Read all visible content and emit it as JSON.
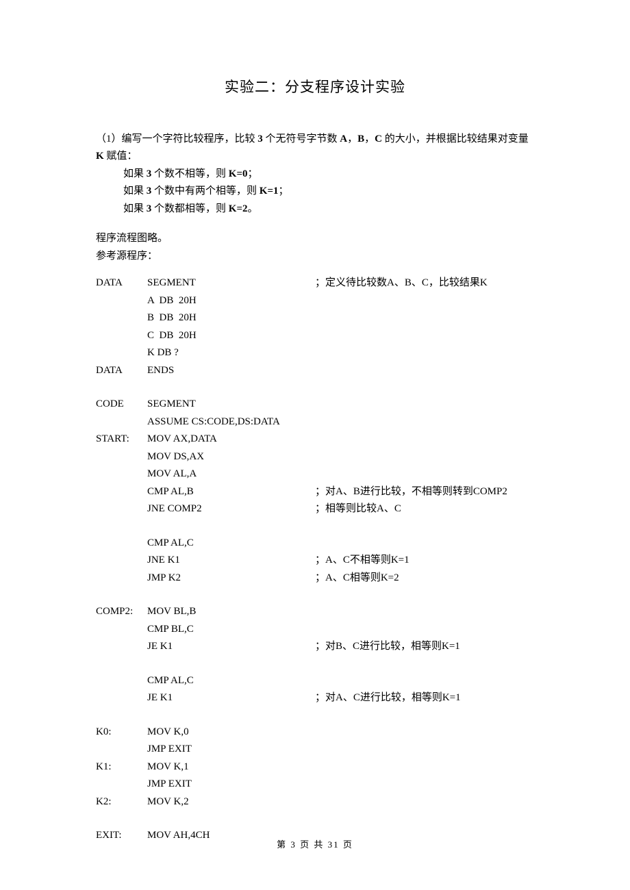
{
  "title": "实验二：分支程序设计实验",
  "intro": {
    "q_prefix": "（1）编写一个字符比较程序，比较 ",
    "q_bold1": "3",
    "q_mid1": " 个无符号字节数 ",
    "q_bold2": "A",
    "q_mid2": "，",
    "q_bold3": "B",
    "q_mid3": "，",
    "q_bold4": "C",
    "q_suffix": " 的大小，并根据比较结果对变量 ",
    "q_bold5": "K",
    "q_suffix2": " 赋值：",
    "cond1_a": "如果 ",
    "cond1_b": "3",
    "cond1_c": " 个数不相等，则 ",
    "cond1_d": "K=0",
    "cond1_e": "；",
    "cond2_a": "如果 ",
    "cond2_b": "3",
    "cond2_c": " 个数中有两个相等，则 ",
    "cond2_d": "K=1",
    "cond2_e": "；",
    "cond3_a": "如果 ",
    "cond3_b": "3",
    "cond3_c": " 个数都相等，则 ",
    "cond3_d": "K=2",
    "cond3_e": "。",
    "flow": "程序流程图略。",
    "ref": "参考源程序："
  },
  "code": [
    {
      "label": "DATA",
      "instr": "SEGMENT",
      "comment": "；定义待比较数A、B、C，比较结果K"
    },
    {
      "label": "",
      "instr": "A  DB  20H",
      "comment": ""
    },
    {
      "label": "",
      "instr": "B  DB  20H",
      "comment": ""
    },
    {
      "label": "",
      "instr": "C  DB  20H",
      "comment": ""
    },
    {
      "label": "",
      "instr": "K DB ?",
      "comment": ""
    },
    {
      "label": "DATA",
      "instr": "ENDS",
      "comment": ""
    },
    {
      "blank": true
    },
    {
      "label": "CODE",
      "instr": "SEGMENT",
      "comment": ""
    },
    {
      "label": "",
      "instr": "ASSUME CS:CODE,DS:DATA",
      "comment": ""
    },
    {
      "label": "START:",
      "instr": "MOV AX,DATA",
      "comment": ""
    },
    {
      "label": "",
      "instr": "MOV DS,AX",
      "comment": ""
    },
    {
      "label": "",
      "instr": "MOV AL,A",
      "comment": ""
    },
    {
      "label": "",
      "instr": "CMP AL,B",
      "comment": "；对A、B进行比较，不相等则转到COMP2"
    },
    {
      "label": "",
      "instr": "JNE COMP2",
      "comment": "；相等则比较A、C"
    },
    {
      "blank": true
    },
    {
      "label": "",
      "instr": "CMP AL,C",
      "comment": ""
    },
    {
      "label": "",
      "instr": "JNE K1",
      "comment": "；A、C不相等则K=1"
    },
    {
      "label": "",
      "instr": "JMP K2",
      "comment": "；A、C相等则K=2"
    },
    {
      "blank": true
    },
    {
      "label": "COMP2:",
      "instr": "MOV BL,B",
      "comment": ""
    },
    {
      "label": "",
      "instr": "CMP BL,C",
      "comment": ""
    },
    {
      "label": "",
      "instr": "JE K1",
      "comment": "；对B、C进行比较，相等则K=1"
    },
    {
      "blank": true
    },
    {
      "label": "",
      "instr": "CMP AL,C",
      "comment": ""
    },
    {
      "label": "",
      "instr": "JE K1",
      "comment": "；对A、C进行比较，相等则K=1"
    },
    {
      "blank": true
    },
    {
      "label": "K0:",
      "instr": "MOV K,0",
      "comment": ""
    },
    {
      "label": "",
      "instr": "JMP EXIT",
      "comment": ""
    },
    {
      "label": "K1:",
      "instr": "MOV K,1",
      "comment": ""
    },
    {
      "label": "",
      "instr": "JMP EXIT",
      "comment": ""
    },
    {
      "label": "K2:",
      "instr": "MOV K,2",
      "comment": ""
    },
    {
      "blank": true
    },
    {
      "label": "EXIT:",
      "instr": "MOV AH,4CH",
      "comment": ""
    }
  ],
  "footer": "第  3  页  共  31  页"
}
